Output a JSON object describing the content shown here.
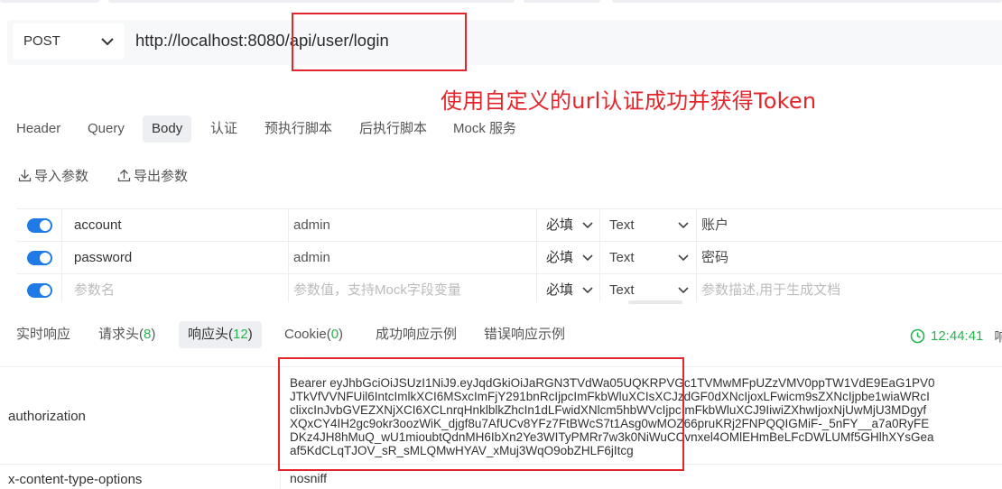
{
  "request": {
    "method": "POST",
    "url": "http://localhost:8080/api/user/login"
  },
  "annotation": {
    "text": "使用自定义的url认证成功并获得Token",
    "color": "#e3262c"
  },
  "request_tabs": [
    {
      "label": "Header"
    },
    {
      "label": "Query"
    },
    {
      "label": "Body",
      "active": true
    },
    {
      "label": "认证"
    },
    {
      "label": "预执行脚本"
    },
    {
      "label": "后执行脚本"
    },
    {
      "label": "Mock 服务"
    }
  ],
  "param_actions": {
    "import_label": "导入参数",
    "export_label": "导出参数"
  },
  "params": [
    {
      "name": "account",
      "value": "admin",
      "required": "必填",
      "type": "Text",
      "desc": "账户",
      "enabled": true
    },
    {
      "name": "password",
      "value": "admin",
      "required": "必填",
      "type": "Text",
      "desc": "密码",
      "enabled": true
    }
  ],
  "new_param": {
    "name_placeholder": "参数名",
    "value_placeholder": "参数值，支持Mock字段变量",
    "required": "必填",
    "type": "Text",
    "desc_placeholder": "参数描述,用于生成文档"
  },
  "response_tabs": {
    "realtime": "实时响应",
    "req_headers": "请求头(",
    "req_headers_count": "8",
    "resp_headers": "响应头(",
    "resp_headers_count": "12",
    "cookie": "Cookie(",
    "cookie_count": "0",
    "close_paren": ")",
    "success_example": "成功响应示例",
    "error_example": "错误响应示例"
  },
  "response_time": "12:44:41",
  "response_extra": "响",
  "response_headers": [
    {
      "name": "authorization",
      "value_lines": [
        "Bearer eyJhbGciOiJSUzI1NiJ9.eyJqdGkiOiJaRGN3TVdWa05UQKRPVGc1TVMwMFpUZzVMV0ppTW1VdE9EaG1PV0",
        "JTkVfVVNFUil6IntcImlkXCI6MSxcImFjY291bnRcIjpcImFkbWluXCIsXCJzdGF0dXNcIjoxLFwicm9sZXNcIjpbe1wiaWRcI",
        "clixcInJvbGVEZXNjXCI6XCLnrqHnklblkZhcIn1dLFwidXNlcm5hbWVcIjpcImFkbWluXCJ9IiwiZXhwIjoxNjUwMjU3MDgyf",
        "XQxCY4IH2gc9okr3oozWiK_djgf8u7AfUCv8YFz7FtBWcS7t1Asg0wMOZ66pruKRj2FNPQQIGMiF-_5nFY__a7a0RyFE",
        "DKz4JH8hMuQ_wU1mioubtQdnMH6IbXn2Ye3WITyPMRr7w3k0NiWuCCvnxel4OMlEHmBeLFcDWLUMf5GHlhXYsGea",
        "af5KdCLqTJOV_sR_sMLQMwHYAV_xMuj3WqO9obZHLF6jItcg"
      ]
    },
    {
      "name": "x-content-type-options",
      "value": "nosniff"
    }
  ]
}
